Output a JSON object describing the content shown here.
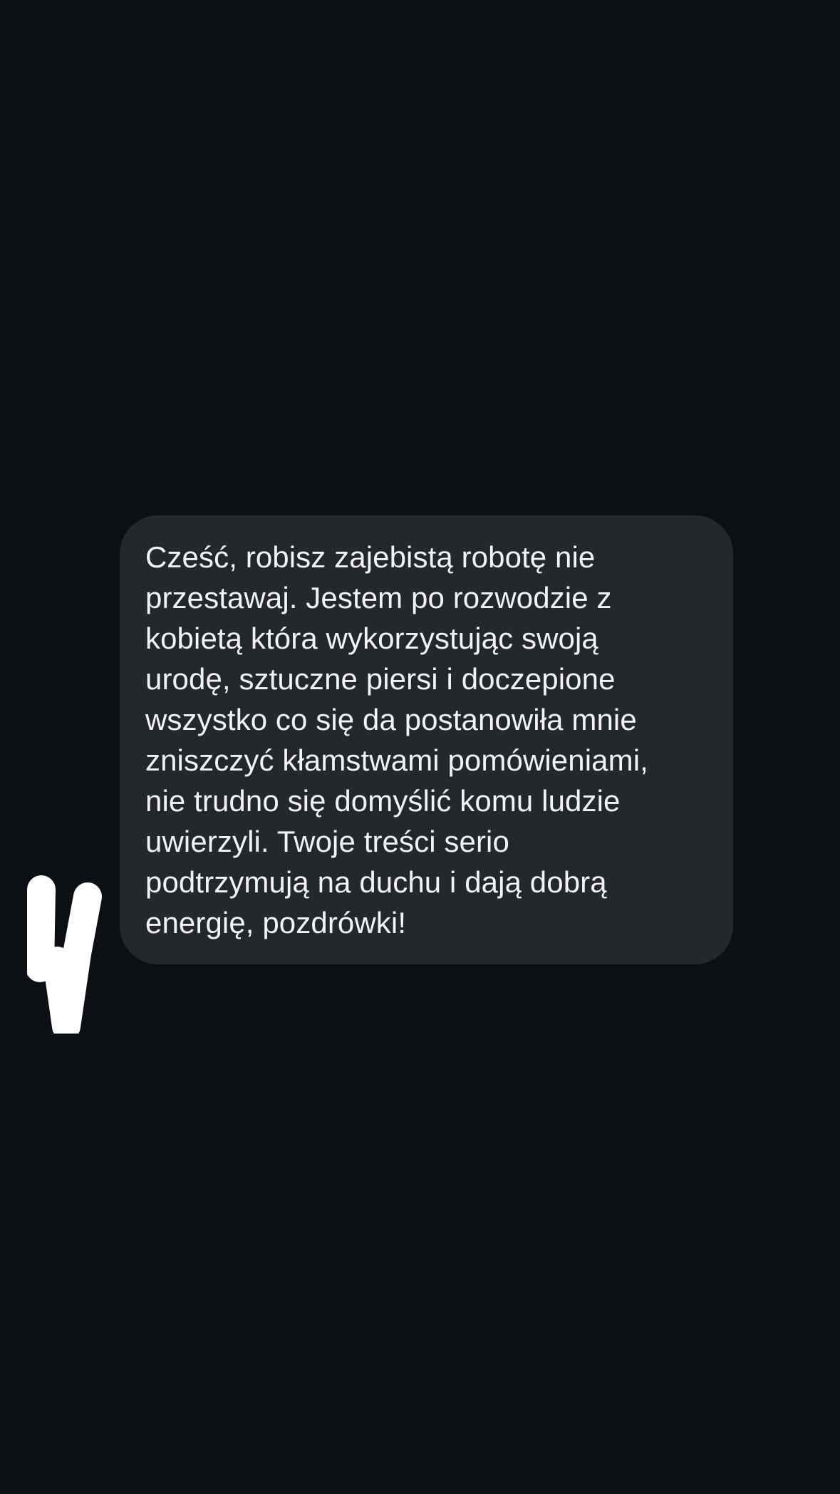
{
  "conversation": {
    "messages": [
      {
        "direction": "incoming",
        "text": "Cześć, robisz zajebistą robotę nie\nprzestawaj. Jestem po rozwodzie z\nkobietą która wykorzystując swoją\nurodę, sztuczne piersi i doczepione\nwszystko co się da postanowiła mnie\nzniszczyć kłamstwami pomówieniami,\nnie trudno się domyślić komu ludzie\nuwierzyli. Twoje treści serio\npodtrzymują na duchu i dają dobrą\nenergię, pozdrówki!"
      }
    ],
    "sender_avatar": {
      "icon": "redacted-avatar-scribble-icon",
      "color": "#ffffff"
    }
  },
  "theme": {
    "background": "#0c0f13",
    "bubble_color": "#24272b",
    "text_color": "#f2f3f5"
  }
}
